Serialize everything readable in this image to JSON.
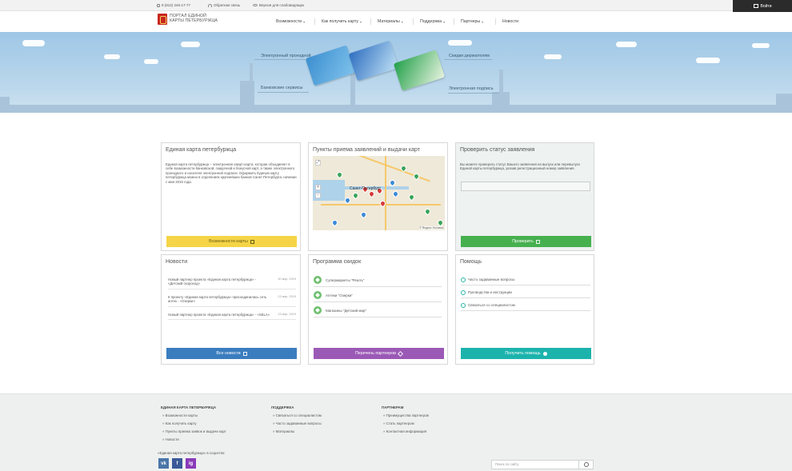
{
  "topbar": {
    "phone": "8 (812) 246-17-77",
    "feedback": "Обратная связь",
    "accessibility": "Версия для слабовидящих",
    "login": "Войти"
  },
  "header": {
    "logo_line1": "Портал единой",
    "logo_line2": "карты Петербуржца",
    "nav": [
      "Возможности",
      "Как получить карту",
      "Материалы",
      "Поддержка",
      "Партнеры",
      "Новости"
    ]
  },
  "hero": {
    "labels": [
      "Электронный проездной",
      "Скидки держателям",
      "Банковские сервисы",
      "Электронная подпись"
    ]
  },
  "panels": {
    "card": {
      "title": "Единая карта петербуржца",
      "text": "Единая карта петербуржца – электронная смарт-карта, которая объединяет в себе возможности банковской, скидочной и бонусной карт, а также электронного проездного и носителя электронной подписи. Оформить Единую карту петербуржца можно в отделениях крупнейших банков Санкт-Петербурга, начиная с мая 2019 года.",
      "button": "Возможности карты"
    },
    "points": {
      "title": "Пункты приема заявлений и выдачи карт",
      "map_city": "Санкт-Петербург",
      "map_credit": "© Яндекс Условия"
    },
    "status": {
      "title": "Проверить статус заявления",
      "text": "Вы можете проверить статус Вашего заявления на выпуск или перевыпуск Единой карты петербуржца, указав регистрационный номер заявления.",
      "button": "Проверить"
    },
    "news": {
      "title": "Новости",
      "items": [
        {
          "text": "Новый партнер проекта «Единая карта петербуржца» - «Детский скороход»",
          "date": "30 мар. 2019"
        },
        {
          "text": "К проекту «Единая карта петербуржца» присоединилась сеть аптек - «Озерки»",
          "date": "23 мар. 2019"
        },
        {
          "text": "Новый партнер проекта «Единая карта петербуржца» - «SELA»",
          "date": "23 мар. 2019"
        }
      ],
      "button": "Все новости"
    },
    "discounts": {
      "title": "Программа скидок",
      "items": [
        "Супермаркеты \"Реалъ\"",
        "Аптеки \"Озерки\"",
        "Магазины \"Детский мир\""
      ],
      "button": "Перечень партнеров"
    },
    "help": {
      "title": "Помощь",
      "items": [
        "Часто задаваемые вопросы",
        "Руководства и инструкции",
        "Связаться со специалистом"
      ],
      "button": "Получить помощь"
    }
  },
  "footer": {
    "col1_title": "Единая карта петербуржца",
    "col1_links": [
      "Возможности карты",
      "Как получить карту",
      "Пункты приема заявок и выдачи карт",
      "Новости"
    ],
    "col2_title": "Поддержка",
    "col2_links": [
      "Связаться со специалистом",
      "Часто задаваемые вопросы",
      "Материалы"
    ],
    "col3_title": "Партнерам",
    "col3_links": [
      "Преимущества партнеров",
      "Стать партнером",
      "Контактная информация"
    ],
    "social_title": "«Единая карта петербуржца» в соцсетях:",
    "social": [
      "vk",
      "f",
      "ig"
    ],
    "search_placeholder": "Поиск по сайту"
  },
  "colors": {
    "yellow": "#f5d547",
    "blue": "#3a7dbf",
    "green": "#46b04f",
    "purple": "#9b59b6",
    "teal": "#1db3ad"
  }
}
